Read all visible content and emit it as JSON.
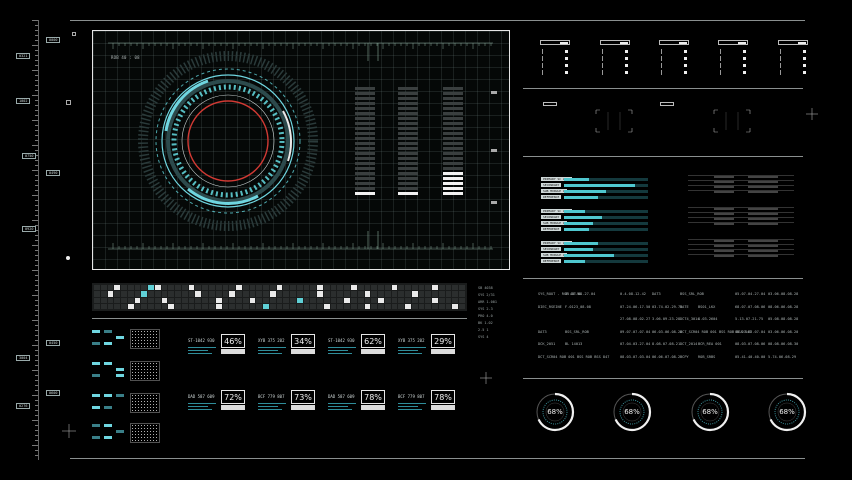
{
  "ruler": {
    "tags": [
      "0000",
      "0321",
      "1002",
      "0750",
      "0490",
      "0920",
      "0450",
      "3004",
      "0600",
      "0276"
    ]
  },
  "viewport": {
    "corner_label": "ROB 40 : 08",
    "bars": [
      {
        "segments": 22,
        "on_from_bottom": [
          0
        ]
      },
      {
        "segments": 22,
        "on_from_bottom": [
          0
        ]
      },
      {
        "segments": 22,
        "on_from_bottom": [
          0,
          1,
          2,
          3,
          4
        ]
      }
    ],
    "colors": {
      "accent": "#5fd0d6",
      "alert": "#d13a34",
      "frame": "#e6e6e6"
    }
  },
  "status_block": [
    "SB 4038",
    "SYS 2/31",
    "ARR 1.001",
    "SYS 2.3",
    "PRO 4.0",
    "BK 1.02",
    "2.5 1",
    "SYS 4"
  ],
  "gauges_top": [
    {
      "label": "ST-1042 930",
      "value": "46%"
    },
    {
      "label": "XYB 375 202",
      "value": "34%"
    },
    {
      "label": "ST-1042 930",
      "value": "62%"
    },
    {
      "label": "XYB 375 202",
      "value": "29%"
    }
  ],
  "gauges_bottom": [
    {
      "label": "DAD 587 609",
      "value": "72%"
    },
    {
      "label": "BCF 779 807",
      "value": "73%"
    },
    {
      "label": "DAD 587 609",
      "value": "78%"
    },
    {
      "label": "BCF 779 807",
      "value": "78%"
    }
  ],
  "right_top_boxes": 5,
  "hbars": {
    "groups": [
      {
        "labels": [
          "PRIMARY SC UNIT",
          "SECONDARY",
          "SUB MODULE A",
          "REFERENCE"
        ],
        "fills": [
          0.3,
          0.85,
          0.5,
          0.4
        ]
      },
      {
        "labels": [
          "PRIMARY SC UNIT",
          "SECONDARY",
          "SUB MODULE A",
          "REFERENCE"
        ],
        "fills": [
          0.25,
          0.45,
          0.35,
          0.3
        ]
      },
      {
        "labels": [
          "PRIMARY SC UNIT",
          "SECONDARY",
          "SUB MODULE A",
          "REFERENCE"
        ],
        "fills": [
          0.4,
          0.35,
          0.6,
          0.25
        ]
      }
    ]
  },
  "data_table": [
    [
      "SYS_ROUT - RCE 07-98",
      "05.07.04.27.04",
      "0.4.08.12.42",
      "DAT3",
      "BSS_SRL_ROB",
      "",
      "05.07.04.27.04",
      "03.06.08.08.28"
    ],
    [
      "DIEC_RSEINE",
      "F.0123_08.08",
      "07.24.06.17.50",
      "03.74.02.29.75",
      "DATE",
      "BS01_LKX",
      "68.07.07.08.06",
      "08.06.06.08.28"
    ],
    [
      "",
      "",
      "27.08.08.02.27",
      "3.06.09.23.28",
      "DCT4_3014",
      "4.03.2604",
      "5.13.07.21.75",
      "05.08.08.08.28"
    ],
    [
      "DAT3",
      "BSS_SRL_ROB",
      "09.07.07.07.04",
      "06.03.06.08.20",
      "DCT_SCR04 ROB 001 BSS ROB BSS 847",
      "",
      "08.07.03.07.04",
      "03.06.06.08.20"
    ],
    [
      "DCK_2051",
      "BL 14013",
      "07.04.03.27.04",
      "8.08.07.08.21",
      "DCT_2014",
      "BCR_REA 001",
      "08.03.07.08.06",
      "08.08.06.08.30"
    ],
    [
      "DCT_SCR04 ROB 001 BSS ROB BSS 847",
      "",
      "08.03.07.03.04",
      "06.06.07.08.2",
      "BCPY",
      "ROB_SRBS",
      "05.41.40.40.00",
      "5.74.06.08.29"
    ]
  ],
  "rings": [
    "68%",
    "68%",
    "68%",
    "68%"
  ]
}
